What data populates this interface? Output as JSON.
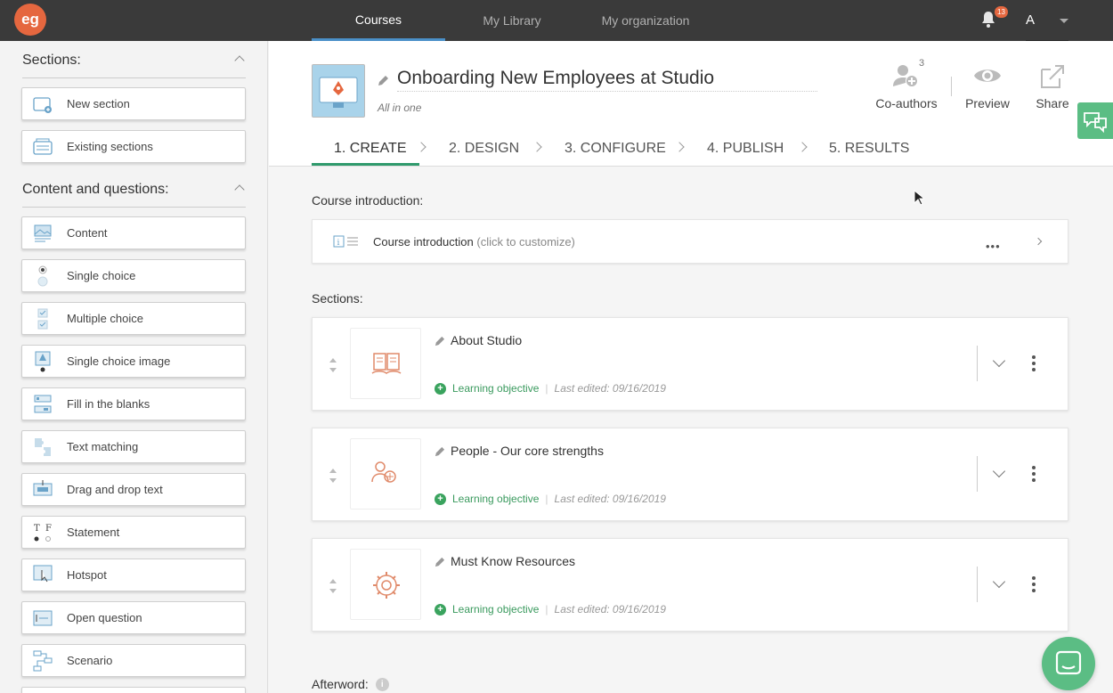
{
  "topnav": {
    "logo": "eg",
    "tabs": [
      {
        "label": "Courses",
        "active": true
      },
      {
        "label": "My Library",
        "active": false
      },
      {
        "label": "My organization",
        "active": false
      }
    ],
    "notification_count": "13",
    "user_initial": "A"
  },
  "sidebar": {
    "sections_header": "Sections:",
    "section_items": [
      {
        "label": "New section",
        "icon": "new-section-icon"
      },
      {
        "label": "Existing sections",
        "icon": "existing-sections-icon"
      }
    ],
    "content_header": "Content and questions:",
    "content_items": [
      {
        "label": "Content",
        "icon": "content-icon"
      },
      {
        "label": "Single choice",
        "icon": "single-choice-icon"
      },
      {
        "label": "Multiple choice",
        "icon": "multiple-choice-icon"
      },
      {
        "label": "Single choice image",
        "icon": "single-choice-image-icon"
      },
      {
        "label": "Fill in the blanks",
        "icon": "fill-blanks-icon"
      },
      {
        "label": "Text matching",
        "icon": "text-matching-icon"
      },
      {
        "label": "Drag and drop text",
        "icon": "drag-drop-icon"
      },
      {
        "label": "Statement",
        "icon": "statement-icon"
      },
      {
        "label": "Hotspot",
        "icon": "hotspot-icon"
      },
      {
        "label": "Open question",
        "icon": "open-question-icon"
      },
      {
        "label": "Scenario",
        "icon": "scenario-icon"
      }
    ]
  },
  "course": {
    "title": "Onboarding New Employees at Studio",
    "subtitle": "All in one",
    "actions": {
      "coauthors": "Co-authors",
      "coauthors_count": "3",
      "preview": "Preview",
      "share": "Share"
    },
    "steps": [
      "1. CREATE",
      "2. DESIGN",
      "3. CONFIGURE",
      "4. PUBLISH",
      "5. RESULTS"
    ]
  },
  "intro": {
    "label": "Course introduction:",
    "card_title": "Course introduction",
    "card_hint": "(click to customize)",
    "more": "•••"
  },
  "sections": {
    "label": "Sections:",
    "items": [
      {
        "title": "About Studio",
        "objective": "Learning objective",
        "edited": "Last edited: 09/16/2019"
      },
      {
        "title": "People - Our core strengths",
        "objective": "Learning objective",
        "edited": "Last edited: 09/16/2019"
      },
      {
        "title": "Must Know Resources",
        "objective": "Learning objective",
        "edited": "Last edited: 09/16/2019"
      }
    ]
  },
  "afterword": {
    "label": "Afterword:"
  },
  "colors": {
    "accent_green": "#2f9a6c",
    "brand_orange": "#e5673f",
    "nav_bg": "#3a3a3a"
  }
}
